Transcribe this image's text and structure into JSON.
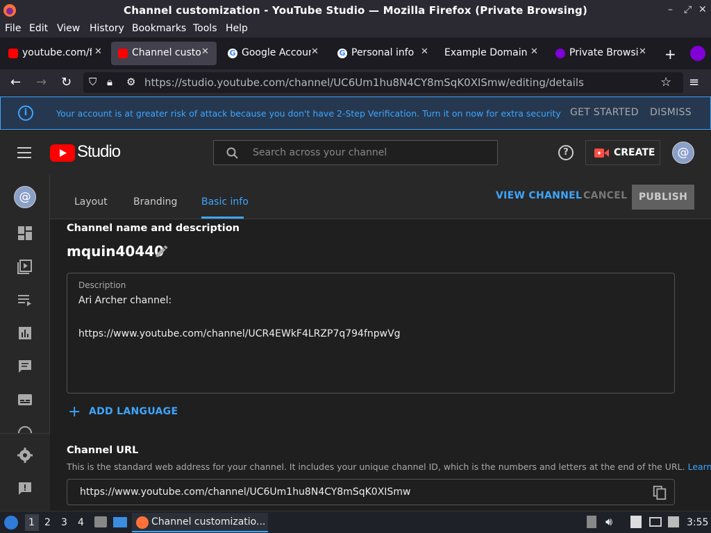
{
  "window": {
    "title": "Channel customization - YouTube Studio — Mozilla Firefox (Private Browsing)"
  },
  "menu": [
    "File",
    "Edit",
    "View",
    "History",
    "Bookmarks",
    "Tools",
    "Help"
  ],
  "tabs": [
    {
      "label": "youtube.com/fe",
      "favicon": "youtube-favicon",
      "active": false
    },
    {
      "label": "Channel custor",
      "favicon": "youtube-favicon",
      "active": true
    },
    {
      "label": "Google Accoun",
      "favicon": "google-favicon",
      "active": false
    },
    {
      "label": "Personal info",
      "favicon": "google-favicon",
      "active": false
    },
    {
      "label": "Example Domain",
      "favicon": "",
      "active": false
    },
    {
      "label": "Private Browsin",
      "favicon": "private-browsing-favicon",
      "active": false
    }
  ],
  "address_bar": {
    "url": "https://studio.youtube.com/channel/UC6Um1hu8N4CY8mSqK0XISmw/editing/details"
  },
  "banner": {
    "message": "Your account is at greater risk of attack because you don't have 2-Step Verification. Turn it on now for extra security",
    "get_started": "GET STARTED",
    "dismiss": "DISMISS"
  },
  "studio_header": {
    "logo_text": "Studio",
    "search_placeholder": "Search across your channel",
    "create_label": "CREATE"
  },
  "page_tabs": [
    "Layout",
    "Branding",
    "Basic info"
  ],
  "active_tab": "Basic info",
  "actions": {
    "view_channel": "VIEW CHANNEL",
    "cancel": "CANCEL",
    "publish": "PUBLISH"
  },
  "channel": {
    "section_title": "Channel name and description",
    "name": "mquin40440",
    "description_label": "Description",
    "description_line1": "Ari Archer channel:",
    "description_line2": "https://www.youtube.com/channel/UCR4EWkF4LRZP7q794fnpwVg",
    "add_language": "ADD LANGUAGE"
  },
  "channel_url": {
    "title": "Channel URL",
    "help": "This is the standard web address for your channel. It includes your unique channel ID, which is the numbers and letters at the end of the URL.",
    "learn_more": "Learn more",
    "value": "https://www.youtube.com/channel/UC6Um1hu8N4CY8mSqK0XISmw"
  },
  "taskbar": {
    "workspaces": [
      "1",
      "2",
      "3",
      "4"
    ],
    "window_label": "Channel customizatio...",
    "clock": "3:55"
  },
  "colors": {
    "accent_blue": "#3ea6ff",
    "youtube_red": "#ff0000",
    "background": "#1f1f1f",
    "panel": "#282828"
  }
}
